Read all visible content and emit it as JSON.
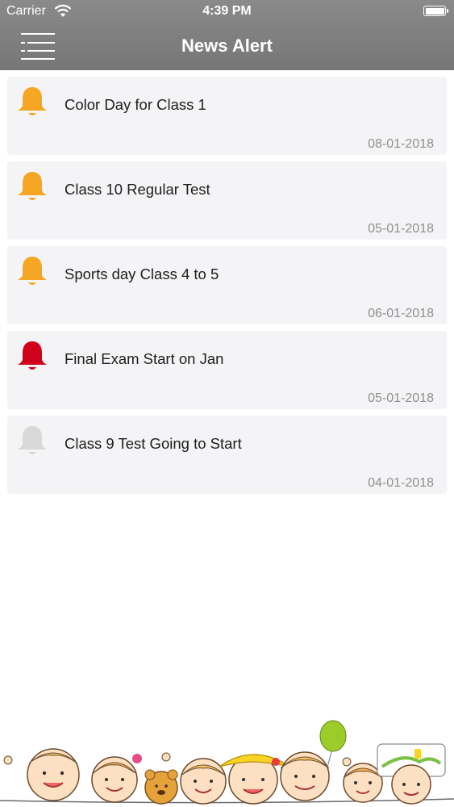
{
  "status_bar": {
    "carrier": "Carrier",
    "time": "4:39 PM"
  },
  "nav": {
    "title": "News Alert"
  },
  "alerts": [
    {
      "title": "Color Day for Class 1",
      "date": "08-01-2018",
      "bell_color": "#f5a623"
    },
    {
      "title": "Class 10 Regular Test",
      "date": "05-01-2018",
      "bell_color": "#f5a623"
    },
    {
      "title": "Sports day Class 4 to 5",
      "date": "06-01-2018",
      "bell_color": "#f5a623"
    },
    {
      "title": "Final Exam Start on Jan",
      "date": "05-01-2018",
      "bell_color": "#d0021b"
    },
    {
      "title": "Class 9 Test Going to Start",
      "date": "04-01-2018",
      "bell_color": "#d8d8d8"
    }
  ],
  "icons": {
    "menu": "menu-icon",
    "bell": "bell-icon",
    "wifi": "wifi-icon",
    "battery": "battery-icon"
  }
}
